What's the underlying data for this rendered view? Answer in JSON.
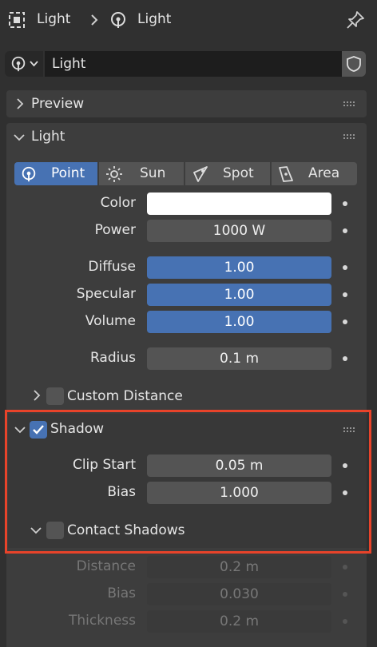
{
  "breadcrumb": {
    "first": "Light",
    "second": "Light"
  },
  "datablock": {
    "name": "Light"
  },
  "panels": {
    "preview": "Preview",
    "light": "Light",
    "shadow": "Shadow",
    "custom_distance": "Custom Distance",
    "contact_shadows": "Contact Shadows"
  },
  "light_types": [
    {
      "label": "Point",
      "icon": "point-light-icon",
      "active": true
    },
    {
      "label": "Sun",
      "icon": "sun-light-icon",
      "active": false
    },
    {
      "label": "Spot",
      "icon": "spot-light-icon",
      "active": false
    },
    {
      "label": "Area",
      "icon": "area-light-icon",
      "active": false
    }
  ],
  "props": {
    "color": {
      "label": "Color",
      "hex": "#ffffff"
    },
    "power": {
      "label": "Power",
      "value": "1000 W"
    },
    "diffuse": {
      "label": "Diffuse",
      "value": "1.00"
    },
    "specular": {
      "label": "Specular",
      "value": "1.00"
    },
    "volume": {
      "label": "Volume",
      "value": "1.00"
    },
    "radius": {
      "label": "Radius",
      "value": "0.1 m"
    }
  },
  "shadow": {
    "enabled": true,
    "clip_start": {
      "label": "Clip Start",
      "value": "0.05 m"
    },
    "bias": {
      "label": "Bias",
      "value": "1.000"
    }
  },
  "contact": {
    "enabled": false,
    "distance": {
      "label": "Distance",
      "value": "0.2 m"
    },
    "bias": {
      "label": "Bias",
      "value": "0.030"
    },
    "thickness": {
      "label": "Thickness",
      "value": "0.2 m"
    }
  },
  "colors": {
    "accent": "#4772b3",
    "highlight_border": "#e8432a"
  }
}
